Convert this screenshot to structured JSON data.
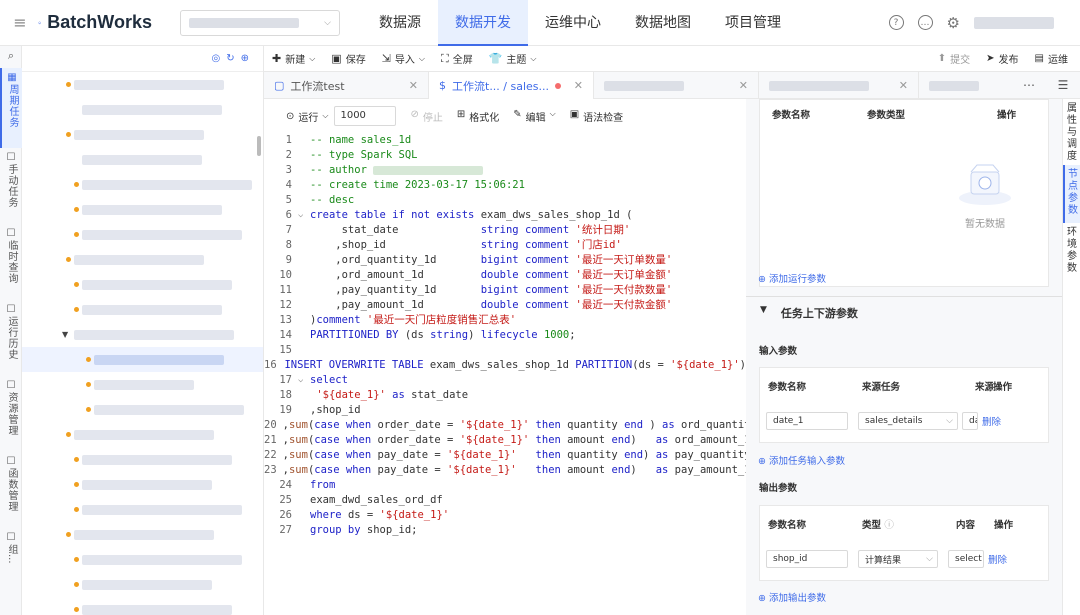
{
  "app": {
    "brand": "BatchWorks"
  },
  "nav": {
    "items": [
      "数据源",
      "数据开发",
      "运维中心",
      "数据地图",
      "项目管理"
    ]
  },
  "leftnav": {
    "items": [
      "周期任务",
      "手动任务",
      "临时查询",
      "运行历史",
      "资源管理",
      "函数管理",
      "组..."
    ]
  },
  "toolbar": {
    "new": "新建",
    "save": "保存",
    "import": "导入",
    "fullscreen": "全屏",
    "theme": "主题",
    "submit": "提交",
    "publish": "发布",
    "ops": "运维"
  },
  "tabs": [
    {
      "label": "工作流test"
    },
    {
      "label": "工作流t... / sales..."
    }
  ],
  "editor": {
    "run_label": "运行",
    "limit": "1000",
    "stop": "停止",
    "format": "格式化",
    "edit": "编辑",
    "check": "语法检查"
  },
  "code": [
    {
      "n": "1",
      "segs": [
        [
          "cm",
          "-- name sales_1d"
        ]
      ]
    },
    {
      "n": "2",
      "segs": [
        [
          "cm",
          "-- type Spark SQL"
        ]
      ]
    },
    {
      "n": "3",
      "segs": [
        [
          "cm",
          "-- author "
        ]
      ]
    },
    {
      "n": "4",
      "segs": [
        [
          "cm",
          "-- create time 2023-03-17 15:06:21"
        ]
      ]
    },
    {
      "n": "5",
      "segs": [
        [
          "cm",
          "-- desc"
        ]
      ]
    },
    {
      "n": "6",
      "segs": [
        [
          "kw",
          "create table if not exists "
        ],
        [
          "",
          "exam_dws_sales_shop_1d ("
        ]
      ]
    },
    {
      "n": "7",
      "segs": [
        [
          "",
          "     stat_date             "
        ],
        [
          "kw",
          "string comment "
        ],
        [
          "str",
          "'统计日期'"
        ]
      ]
    },
    {
      "n": "8",
      "segs": [
        [
          "",
          "    ,shop_id               "
        ],
        [
          "kw",
          "string comment "
        ],
        [
          "str",
          "'门店id'"
        ]
      ]
    },
    {
      "n": "9",
      "segs": [
        [
          "",
          "    ,ord_quantity_1d       "
        ],
        [
          "kw",
          "bigint comment "
        ],
        [
          "str",
          "'最近一天订单数量'"
        ]
      ]
    },
    {
      "n": "10",
      "segs": [
        [
          "",
          "    ,ord_amount_1d         "
        ],
        [
          "kw",
          "double comment "
        ],
        [
          "str",
          "'最近一天订单金额'"
        ]
      ]
    },
    {
      "n": "11",
      "segs": [
        [
          "",
          "    ,pay_quantity_1d       "
        ],
        [
          "kw",
          "bigint comment "
        ],
        [
          "str",
          "'最近一天付款数量'"
        ]
      ]
    },
    {
      "n": "12",
      "segs": [
        [
          "",
          "    ,pay_amount_1d         "
        ],
        [
          "kw",
          "double comment "
        ],
        [
          "str",
          "'最近一天付款金额'"
        ]
      ]
    },
    {
      "n": "13",
      "segs": [
        [
          "",
          ")"
        ],
        [
          "kw",
          "comment "
        ],
        [
          "str",
          "'最近一天门店粒度销售汇总表'"
        ]
      ]
    },
    {
      "n": "14",
      "segs": [
        [
          "kw",
          "PARTITIONED BY "
        ],
        [
          "",
          "(ds "
        ],
        [
          "kw",
          "string"
        ],
        [
          "",
          ") "
        ],
        [
          "kw",
          "lifecycle "
        ],
        [
          "num",
          "1000"
        ],
        [
          "",
          ";"
        ]
      ]
    },
    {
      "n": "15",
      "segs": [
        [
          "",
          ""
        ]
      ]
    },
    {
      "n": "16",
      "segs": [
        [
          "kw",
          "INSERT OVERWRITE TABLE "
        ],
        [
          "",
          "exam_dws_sales_shop_1d "
        ],
        [
          "kw",
          "PARTITION"
        ],
        [
          "",
          "(ds = "
        ],
        [
          "str",
          "'${date_1}'"
        ],
        [
          "",
          ")"
        ]
      ]
    },
    {
      "n": "17",
      "segs": [
        [
          "kw",
          "select"
        ]
      ]
    },
    {
      "n": "18",
      "segs": [
        [
          "str",
          " '${date_1}'"
        ],
        [
          "kw",
          " as "
        ],
        [
          "",
          "stat_date"
        ]
      ]
    },
    {
      "n": "19",
      "segs": [
        [
          "",
          ",shop_id"
        ]
      ]
    },
    {
      "n": "20",
      "segs": [
        [
          "",
          ","
        ],
        [
          "fn",
          "sum"
        ],
        [
          "",
          "("
        ],
        [
          "kw",
          "case when "
        ],
        [
          "",
          "order_date = "
        ],
        [
          "str",
          "'${date_1}'"
        ],
        [
          "kw",
          " then "
        ],
        [
          "",
          "quantity "
        ],
        [
          "kw",
          "end"
        ],
        [
          "",
          " ) "
        ],
        [
          "kw",
          "as "
        ],
        [
          "",
          "ord_quantity"
        ]
      ]
    },
    {
      "n": "21",
      "segs": [
        [
          "",
          ","
        ],
        [
          "fn",
          "sum"
        ],
        [
          "",
          "("
        ],
        [
          "kw",
          "case when "
        ],
        [
          "",
          "order_date = "
        ],
        [
          "str",
          "'${date_1}'"
        ],
        [
          "kw",
          " then "
        ],
        [
          "",
          "amount "
        ],
        [
          "kw",
          "end"
        ],
        [
          "",
          ")   "
        ],
        [
          "kw",
          "as "
        ],
        [
          "",
          "ord_amount_1"
        ]
      ]
    },
    {
      "n": "22",
      "segs": [
        [
          "",
          ","
        ],
        [
          "fn",
          "sum"
        ],
        [
          "",
          "("
        ],
        [
          "kw",
          "case when "
        ],
        [
          "",
          "pay_date = "
        ],
        [
          "str",
          "'${date_1}'"
        ],
        [
          "kw",
          "   then "
        ],
        [
          "",
          "quantity "
        ],
        [
          "kw",
          "end"
        ],
        [
          "",
          ") "
        ],
        [
          "kw",
          "as "
        ],
        [
          "",
          "pay_quantity"
        ]
      ]
    },
    {
      "n": "23",
      "segs": [
        [
          "",
          ","
        ],
        [
          "fn",
          "sum"
        ],
        [
          "",
          "("
        ],
        [
          "kw",
          "case when "
        ],
        [
          "",
          "pay_date = "
        ],
        [
          "str",
          "'${date_1}'"
        ],
        [
          "kw",
          "   then "
        ],
        [
          "",
          "amount "
        ],
        [
          "kw",
          "end"
        ],
        [
          "",
          ")   "
        ],
        [
          "kw",
          "as "
        ],
        [
          "",
          "pay_amount_1"
        ]
      ]
    },
    {
      "n": "24",
      "segs": [
        [
          "kw",
          "from"
        ]
      ]
    },
    {
      "n": "25",
      "segs": [
        [
          "",
          "exam_dwd_sales_ord_df"
        ]
      ]
    },
    {
      "n": "26",
      "segs": [
        [
          "kw",
          "where "
        ],
        [
          "",
          "ds = "
        ],
        [
          "str",
          "'${date_1}'"
        ]
      ]
    },
    {
      "n": "27",
      "segs": [
        [
          "kw",
          "group by "
        ],
        [
          "",
          "shop_id;"
        ]
      ]
    }
  ],
  "params": {
    "head": {
      "name": "参数名称",
      "type": "参数类型",
      "op": "操作"
    },
    "empty": "暂无数据",
    "add_run": "添加运行参数",
    "section": "任务上下游参数",
    "input_title": "输入参数",
    "in_head": {
      "name": "参数名称",
      "src": "来源任务",
      "src2": "来源",
      "op": "操作"
    },
    "in_row": {
      "name": "date_1",
      "src": "sales_details",
      "src2": "da",
      "del": "删除"
    },
    "add_in": "添加任务输入参数",
    "output_title": "输出参数",
    "out_head": {
      "name": "参数名称",
      "type": "类型",
      "content": "内容",
      "op": "操作"
    },
    "out_row": {
      "name": "shop_id",
      "type": "计算结果",
      "content": "select",
      "del": "删除"
    },
    "add_out": "添加输出参数"
  },
  "side_tabs": [
    "属性与调度",
    "节点参数",
    "环境参数"
  ]
}
